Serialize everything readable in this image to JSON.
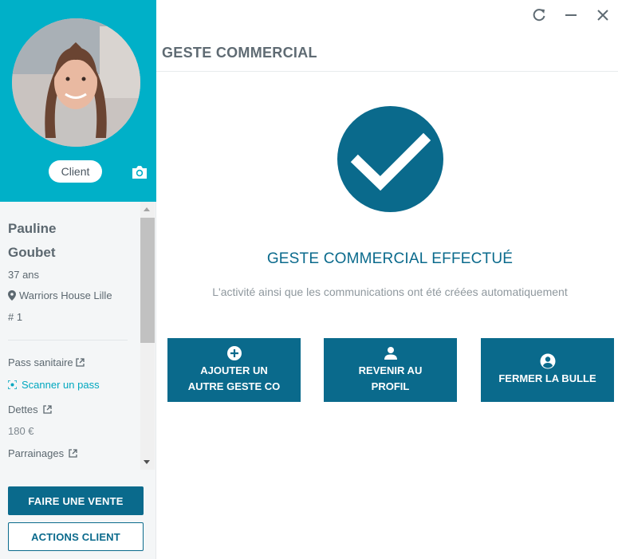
{
  "sidebar": {
    "badge_label": "Client",
    "first_name": "Pauline",
    "last_name": "Goubet",
    "age": "37 ans",
    "location": "Warriors House Lille",
    "number": "# 1",
    "pass_label": "Pass sanitaire",
    "scan_label": "Scanner un pass",
    "dettes_label": "Dettes",
    "dettes_value": "180 €",
    "parrainages_label": "Parrainages",
    "primary_button": "FAIRE UNE VENTE",
    "secondary_button": "ACTIONS CLIENT"
  },
  "main": {
    "title": "GESTE COMMERCIAL",
    "success_heading": "GESTE COMMERCIAL EFFECTUÉ",
    "success_sub": "L'activité ainsi que les communications ont été créées automatiquement",
    "actions": [
      {
        "line1": "AJOUTER UN",
        "line2": "AUTRE GESTE CO",
        "icon": "plus-circle-icon"
      },
      {
        "line1": "REVENIR AU",
        "line2": "PROFIL",
        "icon": "person-icon"
      },
      {
        "line1": "FERMER LA BULLE",
        "line2": "",
        "icon": "account-circle-icon"
      }
    ]
  },
  "colors": {
    "accent": "#0a6a8c",
    "header_teal": "#00b0c8",
    "link": "#00a7bf"
  }
}
